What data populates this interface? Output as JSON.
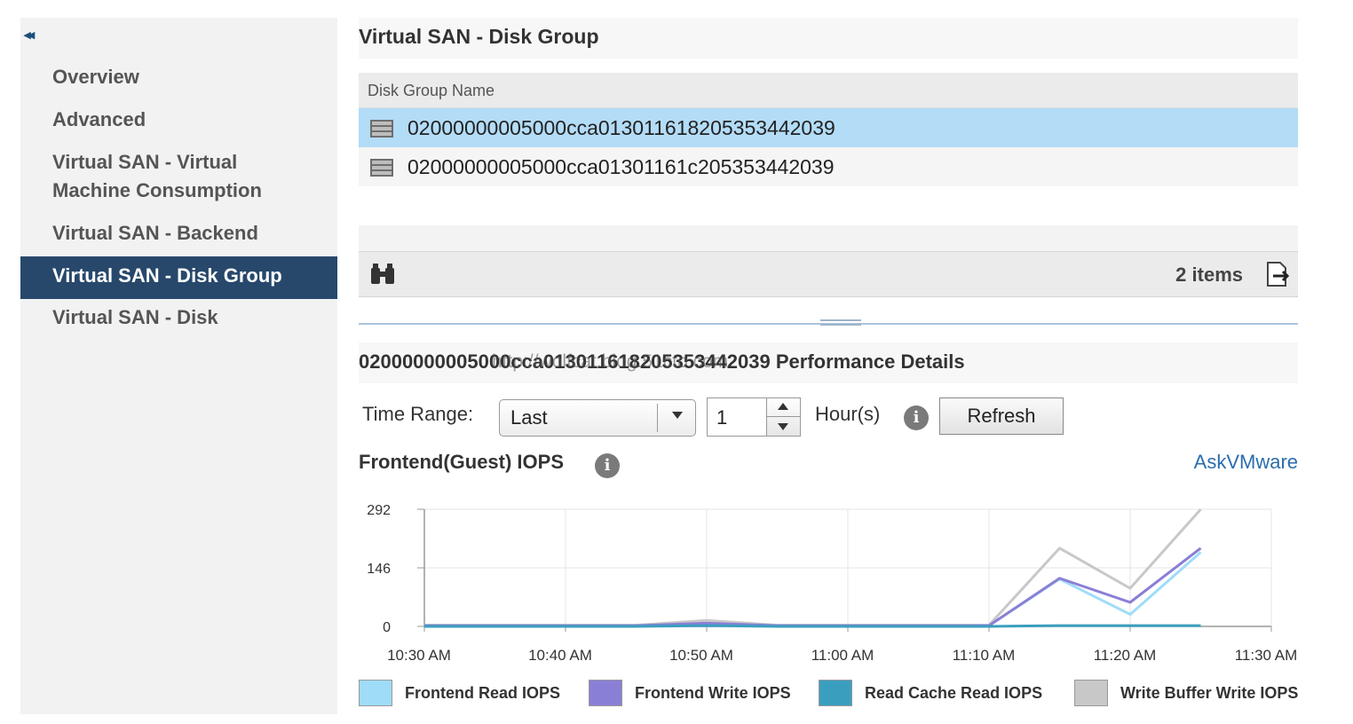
{
  "sidebar": {
    "collapse_glyph": "◂◂",
    "items": [
      {
        "label": "Overview"
      },
      {
        "label": "Advanced"
      },
      {
        "label": "Virtual SAN - Virtual"
      },
      {
        "label": "Machine Consumption"
      },
      {
        "label": "Virtual SAN - Backend"
      },
      {
        "label": "Virtual SAN - Disk Group"
      },
      {
        "label": "Virtual SAN - Disk"
      }
    ]
  },
  "main": {
    "title": "Virtual SAN - Disk Group",
    "table": {
      "column_header": "Disk Group Name",
      "rows": [
        {
          "name": "02000000005000cca01301161820535344203​9"
        },
        {
          "name": "02000000005000cca01301161c205353442039"
        }
      ],
      "items_count": "2 items"
    },
    "perf": {
      "header_prefix": "0200000000500",
      "header_suffix": "0cca01301161820535344203​9 Performance Details",
      "watermark": "http://wolfcat.blog.51cto.com",
      "time_range_label": "Time Range:",
      "time_range_value": "Last",
      "hours_value": "1",
      "hours_label": "Hour(s)",
      "refresh_label": "Refresh",
      "chart_title": "Frontend(Guest) IOPS",
      "ask_link": "AskVMware"
    }
  },
  "colors": {
    "frontend_read": "#9fdcf7",
    "frontend_write": "#8a7fd6",
    "read_cache": "#3a9fbf",
    "write_buffer": "#c8c8c8",
    "selected_nav": "#27486b",
    "selected_row": "#b3dcf7"
  },
  "chart_data": {
    "type": "line",
    "x": [
      "10:30 AM",
      "10:35 AM",
      "10:40 AM",
      "10:45 AM",
      "10:50 AM",
      "10:55 AM",
      "11:00 AM",
      "11:05 AM",
      "11:10 AM",
      "11:15 AM",
      "11:20 AM",
      "11:25 AM"
    ],
    "xticks": [
      "10:30 AM",
      "10:40 AM",
      "10:50 AM",
      "11:00 AM",
      "11:10 AM",
      "11:20 AM",
      "11:30 AM"
    ],
    "yticks": [
      "292",
      "146",
      "0"
    ],
    "ylim": [
      0,
      292
    ],
    "grid": true,
    "legend_position": "bottom",
    "series": [
      {
        "name": "Frontend Read IOPS",
        "values": [
          2,
          2,
          2,
          2,
          5,
          2,
          2,
          2,
          2,
          118,
          30,
          185
        ]
      },
      {
        "name": "Frontend Write IOPS",
        "values": [
          2,
          2,
          2,
          2,
          8,
          2,
          2,
          2,
          2,
          120,
          60,
          195
        ]
      },
      {
        "name": "Read Cache Read IOPS",
        "values": [
          0,
          0,
          0,
          0,
          2,
          0,
          0,
          0,
          0,
          2,
          2,
          2
        ]
      },
      {
        "name": "Write Buffer Write IOPS",
        "values": [
          3,
          3,
          3,
          3,
          15,
          3,
          3,
          3,
          3,
          195,
          95,
          292
        ]
      }
    ]
  }
}
